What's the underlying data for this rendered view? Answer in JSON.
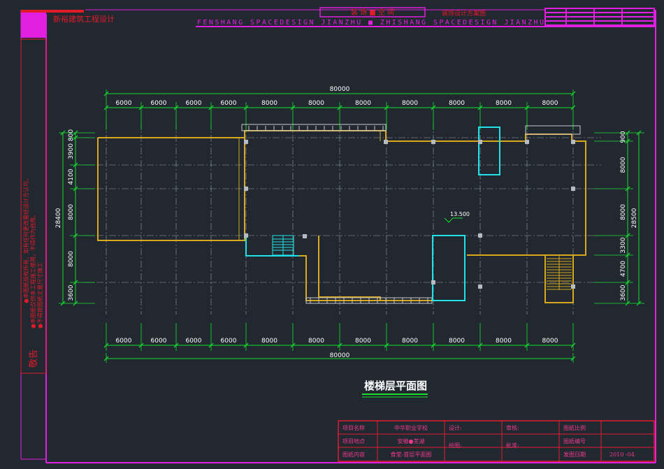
{
  "colors": {
    "background": "#212830",
    "frame": "#e21ee0",
    "dim_line": "#16e02c",
    "dim_text": "#ffffff",
    "wall": "#d8a81e",
    "grid_axis": "#9aa2aa",
    "cyan": "#1ee3e8",
    "red": "#e21b2b",
    "title_block_text": "#f03a8c"
  },
  "header": {
    "company": "新裕建筑工程设计",
    "banner_center": "装 饰 ■ 空 间",
    "banner_right": "装饰设计方案图",
    "scrolling_text": "FENSHANG  SPACEDESIGN JIANZHU ■ ZHISHANG  SPACEDESIGN JIANZHU"
  },
  "side_notes": {
    "title": "敬告",
    "line1": "●本图纸版权所有，如有任何更改需经设计方认可。",
    "line2": "●本图纸仅供本工程施工使用，不得作为他用。",
    "line3": "●不得按图纸丈量尺寸施工"
  },
  "plan": {
    "title": "楼梯层平面图",
    "elevation_label": "13.500",
    "top_total": "80000",
    "bottom_total": "80000",
    "top_spans": [
      "6000",
      "6000",
      "6000",
      "6000",
      "8000",
      "8000",
      "8000",
      "8000",
      "8000",
      "8000",
      "8000"
    ],
    "bottom_spans": [
      "6000",
      "6000",
      "6000",
      "6000",
      "8000",
      "8000",
      "8000",
      "8000",
      "8000",
      "8000",
      "8000"
    ],
    "left_spans": [
      "800",
      "3900",
      "4100",
      "8000",
      "8000",
      "3600"
    ],
    "left_total": "28400",
    "right_spans": [
      "900",
      "8000",
      "8000",
      "3300",
      "4700",
      "3600"
    ],
    "right_total": "28500"
  },
  "title_block": {
    "project_name_label": "项目名称",
    "project_name_value": "中华职业学校",
    "project_location_label": "项目地点",
    "project_location_value": "安徽●芜湖",
    "drawing_content_label": "图纸内容",
    "drawing_content_value": "食堂-首层平面图",
    "design_label": "设计:",
    "draw_label": "绘图:",
    "review_label": "审核:",
    "approve_label": "批准:",
    "scale_label": "图纸比例",
    "number_label": "图纸编号",
    "date_label": "发图日期",
    "date_value": "2010 -04"
  }
}
